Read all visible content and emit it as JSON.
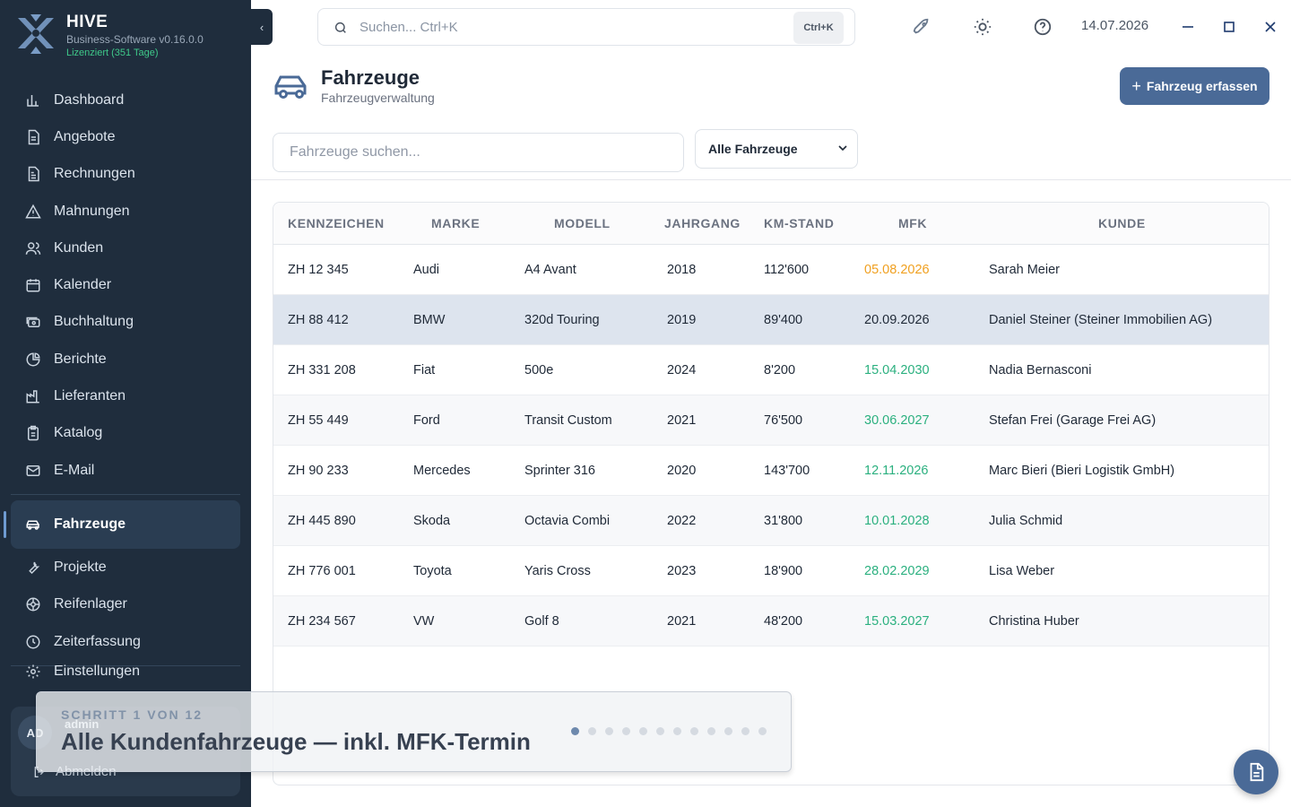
{
  "app": {
    "name": "HIVE",
    "version": "Business-Software v0.16.0.0",
    "license": "Lizenziert (351 Tage)"
  },
  "sidebar": {
    "items": [
      {
        "label": "Dashboard",
        "icon": "chart-bar-icon"
      },
      {
        "label": "Angebote",
        "icon": "document-icon"
      },
      {
        "label": "Rechnungen",
        "icon": "invoice-icon"
      },
      {
        "label": "Mahnungen",
        "icon": "warning-icon"
      },
      {
        "label": "Kunden",
        "icon": "users-icon"
      },
      {
        "label": "Kalender",
        "icon": "calendar-icon"
      },
      {
        "label": "Buchhaltung",
        "icon": "cash-icon"
      },
      {
        "label": "Berichte",
        "icon": "pie-chart-icon"
      },
      {
        "label": "Lieferanten",
        "icon": "factory-icon"
      },
      {
        "label": "Katalog",
        "icon": "clipboard-icon"
      },
      {
        "label": "E-Mail",
        "icon": "mail-icon"
      }
    ],
    "active": {
      "label": "Fahrzeuge",
      "icon": "car-icon"
    },
    "more_items": [
      {
        "label": "Projekte",
        "icon": "wrench-icon"
      },
      {
        "label": "Reifenlager",
        "icon": "tire-icon"
      },
      {
        "label": "Zeiterfassung",
        "icon": "clock-icon"
      }
    ],
    "settings": "Einstellungen",
    "user": {
      "initials": "AD",
      "name": "admin",
      "logout": "Abmelden"
    }
  },
  "topbar": {
    "search_placeholder": "Suchen...   Ctrl+K",
    "search_shortcut": "Ctrl+K",
    "date": "14.07.2026"
  },
  "page": {
    "title": "Fahrzeuge",
    "subtitle": "Fahrzeugverwaltung",
    "add_button": "Fahrzeug erfassen",
    "filter_placeholder": "Fahrzeuge suchen...",
    "filter_select": "Alle Fahrzeuge"
  },
  "table": {
    "headers": [
      "KENNZEICHEN",
      "MARKE",
      "MODELL",
      "JAHRGANG",
      "KM-STAND",
      "MFK",
      "KUNDE"
    ],
    "rows": [
      {
        "plate": "ZH 12 345",
        "brand": "Audi",
        "model": "A4 Avant",
        "year": "2018",
        "km": "112'600",
        "mfk": "05.08.2026",
        "mfk_status": "warning",
        "customer": "Sarah Meier"
      },
      {
        "plate": "ZH 88 412",
        "brand": "BMW",
        "model": "320d Touring",
        "year": "2019",
        "km": "89'400",
        "mfk": "20.09.2026",
        "mfk_status": "neutral",
        "customer": "Daniel Steiner (Steiner Immobilien AG)"
      },
      {
        "plate": "ZH 331 208",
        "brand": "Fiat",
        "model": "500e",
        "year": "2024",
        "km": "8'200",
        "mfk": "15.04.2030",
        "mfk_status": "ok",
        "customer": "Nadia Bernasconi"
      },
      {
        "plate": "ZH 55 449",
        "brand": "Ford",
        "model": "Transit Custom",
        "year": "2021",
        "km": "76'500",
        "mfk": "30.06.2027",
        "mfk_status": "ok",
        "customer": "Stefan Frei (Garage Frei AG)"
      },
      {
        "plate": "ZH 90 233",
        "brand": "Mercedes",
        "model": "Sprinter 316",
        "year": "2020",
        "km": "143'700",
        "mfk": "12.11.2026",
        "mfk_status": "ok",
        "customer": "Marc Bieri (Bieri Logistik GmbH)"
      },
      {
        "plate": "ZH 445 890",
        "brand": "Skoda",
        "model": "Octavia Combi",
        "year": "2022",
        "km": "31'800",
        "mfk": "10.01.2028",
        "mfk_status": "ok",
        "customer": "Julia Schmid"
      },
      {
        "plate": "ZH 776 001",
        "brand": "Toyota",
        "model": "Yaris Cross",
        "year": "2023",
        "km": "18'900",
        "mfk": "28.02.2029",
        "mfk_status": "ok",
        "customer": "Lisa Weber"
      },
      {
        "plate": "ZH 234 567",
        "brand": "VW",
        "model": "Golf 8",
        "year": "2021",
        "km": "48'200",
        "mfk": "15.03.2027",
        "mfk_status": "ok",
        "customer": "Christina Huber"
      }
    ]
  },
  "tour": {
    "step": "SCHRITT 1 VON 12",
    "title": "Alle Kundenfahrzeuge — inkl. MFK-Termin",
    "total": 12,
    "current": 1
  },
  "colors": {
    "sidebar": "#1f2d3d",
    "primary": "#4a6a97",
    "mfk_warning": "#f0a020",
    "mfk_ok": "#2bb07f",
    "mfk_neutral": "#1f2937"
  }
}
